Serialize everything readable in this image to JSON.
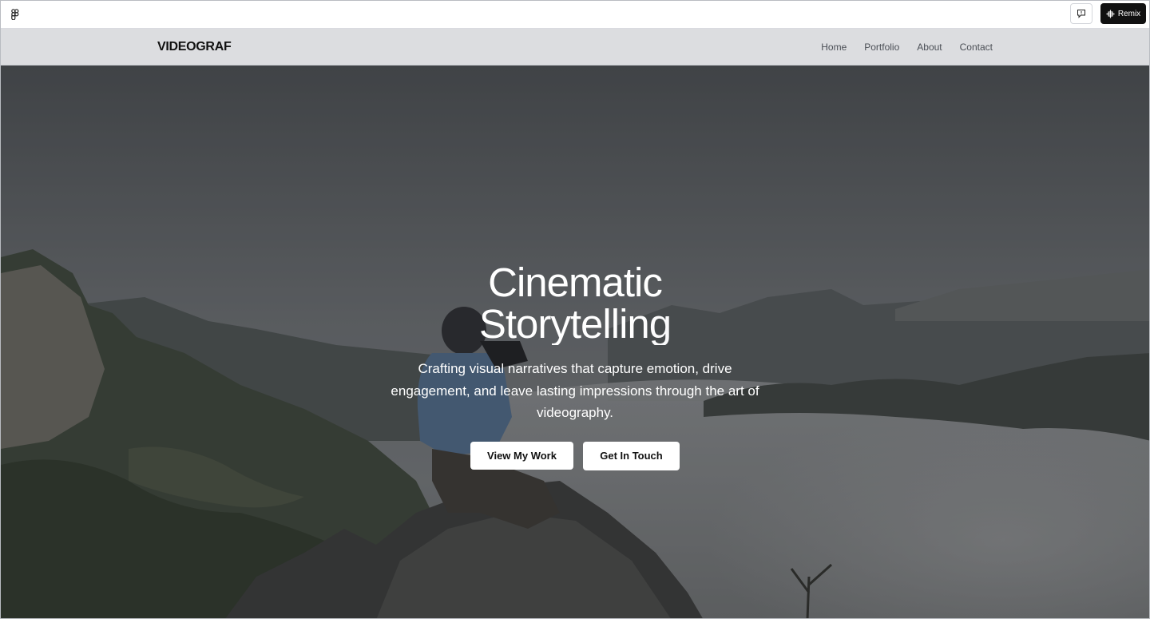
{
  "topbar": {
    "logo_icon": "figma-logo-icon",
    "comment_icon": "feedback-icon",
    "remix_icon": "remix-icon",
    "remix_label": "Remix"
  },
  "nav": {
    "brand": "VIDEOGRAF",
    "links": [
      "Home",
      "Portfolio",
      "About",
      "Contact"
    ]
  },
  "hero": {
    "title_line1": "Cinematic",
    "title_line2": "Storytelling",
    "subtitle": "Crafting visual narratives that capture emotion, drive engagement, and leave lasting impressions through the art of videography.",
    "primary_cta": "View My Work",
    "secondary_cta": "Get In Touch",
    "background_image": "photographer-on-mountain-peak"
  },
  "colors": {
    "nav_bg": "#dcdde0",
    "remix_bg": "#111111",
    "button_bg": "#ffffff",
    "text_light": "#ffffff"
  }
}
